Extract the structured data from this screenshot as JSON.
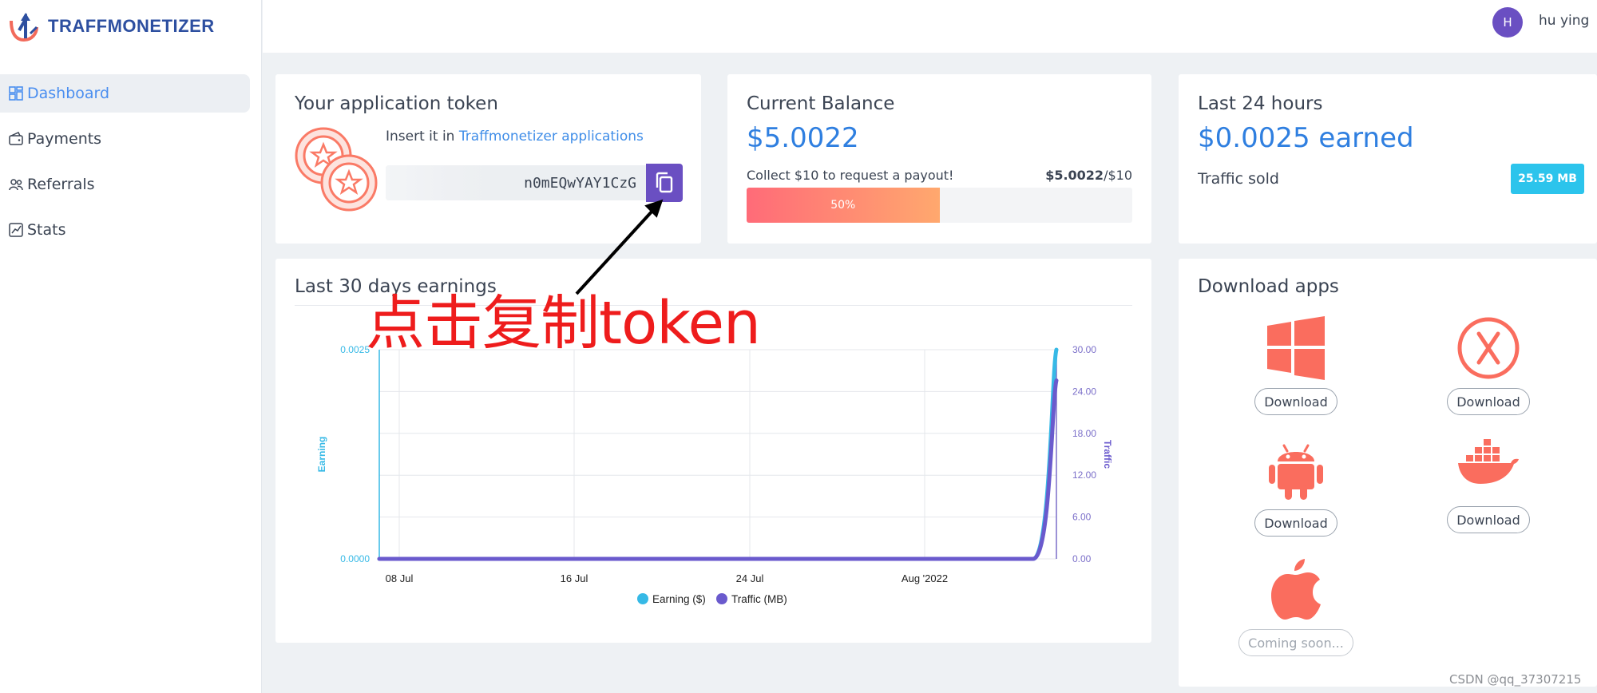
{
  "brand": {
    "name": "TRAFFMONETIZER"
  },
  "sidebar": {
    "items": [
      {
        "label": "Dashboard",
        "icon": "dashboard-icon",
        "active": true
      },
      {
        "label": "Payments",
        "icon": "wallet-icon",
        "active": false
      },
      {
        "label": "Referrals",
        "icon": "users-icon",
        "active": false
      },
      {
        "label": "Stats",
        "icon": "chart-icon",
        "active": false
      }
    ]
  },
  "user": {
    "initial": "H",
    "name": "hu ying"
  },
  "token_card": {
    "title": "Your application token",
    "insert_prefix": "Insert it in ",
    "insert_link": "Traffmonetizer applications",
    "token_value": "n0mEQwYAY1CzG"
  },
  "balance_card": {
    "title": "Current Balance",
    "amount": "$5.0022",
    "collect_text": "Collect $10 to request a payout!",
    "current": "$5.0022",
    "goal": "/$10",
    "progress_percent": 50,
    "progress_label": "50%"
  },
  "last24_card": {
    "title": "Last 24 hours",
    "earned": "$0.0025 earned",
    "traffic_label": "Traffic sold",
    "traffic_value": "25.59 MB"
  },
  "chart_card": {
    "title": "Last 30 days earnings"
  },
  "chart_data": {
    "type": "line",
    "x_ticks": [
      "08 Jul",
      "16 Jul",
      "24 Jul",
      "Aug '2022"
    ],
    "ylabel_left": "Earning",
    "ylabel_right": "Traffic",
    "y_left_ticks": [
      "0.0025",
      "0.0000"
    ],
    "y_left_range": [
      0,
      0.0025
    ],
    "y_right_ticks": [
      "30.00",
      "24.00",
      "18.00",
      "12.00",
      "6.00",
      "0.00"
    ],
    "y_right_range": [
      0,
      30
    ],
    "series": [
      {
        "name": "Earning ($)",
        "color": "#36b9e6",
        "axis": "left",
        "values": [
          0,
          0,
          0,
          0,
          0,
          0,
          0,
          0,
          0,
          0,
          0,
          0,
          0,
          0,
          0,
          0,
          0,
          0,
          0,
          0,
          0,
          0,
          0,
          0,
          0,
          0,
          0,
          0,
          0,
          0.0025
        ]
      },
      {
        "name": "Traffic (MB)",
        "color": "#6a5acd",
        "axis": "right",
        "values": [
          0,
          0,
          0,
          0,
          0,
          0,
          0,
          0,
          0,
          0,
          0,
          0,
          0,
          0,
          0,
          0,
          0,
          0,
          0,
          0,
          0,
          0,
          0,
          0,
          0,
          0,
          0,
          0,
          0,
          25.59
        ]
      }
    ],
    "grid": true,
    "legend_position": "bottom-center"
  },
  "apps_card": {
    "title": "Download apps",
    "apps": [
      {
        "platform": "windows",
        "icon": "windows-icon",
        "button": "Download"
      },
      {
        "platform": "other",
        "icon": "x-circle-icon",
        "button": "Download"
      },
      {
        "platform": "android",
        "icon": "android-icon",
        "button": "Download"
      },
      {
        "platform": "docker",
        "icon": "docker-icon",
        "button": "Download"
      },
      {
        "platform": "apple",
        "icon": "apple-icon",
        "button": "Coming soon..."
      }
    ]
  },
  "annotation": {
    "text": "点击复制token",
    "color": "#ee1c1c"
  },
  "watermark": "CSDN @qq_37307215",
  "colors": {
    "accent": "#6a4fc2",
    "link": "#3f8de8",
    "amount": "#2f7fe0",
    "badge": "#2cc4ec",
    "app_icon": "#fa6d5e"
  }
}
